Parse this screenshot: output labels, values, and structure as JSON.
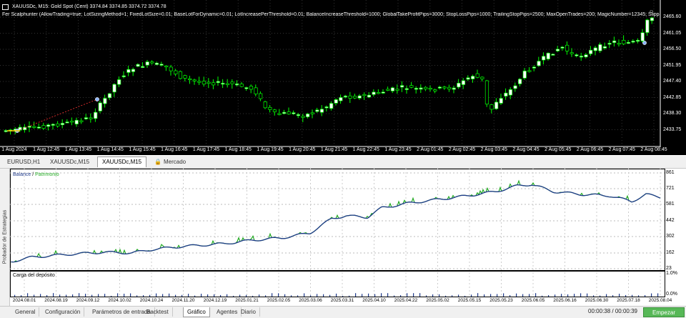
{
  "chart": {
    "header": "XAUUSDc, M15:  Gold Spot (Cent)  3374.84 3374.85 3374.72 3374.78",
    "ea_params": "Fer Scalphunter (AllowTrading=true; LotSizingMethod=1; FixedLotSize=0.01; BaseLotForDynamic=0.01; LotIncreasePerThreshold=0.01; BalanceIncreaseThreshold=1000; GlobalTakeProfitPips=3000; StopLossPips=1000; TrailingStopPips=2500; MaxOpenTrades=200; MagicNumber=12345; SlippagePips=5; AllowInversion=...",
    "price_labels": [
      "2465.60",
      "2461.05",
      "2456.50",
      "2451.95",
      "2447.40",
      "2442.85",
      "2438.30",
      "2433.75"
    ],
    "time_labels": [
      "1 Aug 2024",
      "1 Aug 12:45",
      "1 Aug 13:45",
      "1 Aug 14:45",
      "1 Aug 15:45",
      "1 Aug 16:45",
      "1 Aug 17:45",
      "1 Aug 18:45",
      "1 Aug 19:45",
      "1 Aug 20:45",
      "1 Aug 21:45",
      "1 Aug 22:45",
      "1 Aug 23:45",
      "2 Aug 01:45",
      "2 Aug 02:45",
      "2 Aug 03:45",
      "2 Aug 04:45",
      "2 Aug 05:45",
      "2 Aug 06:45",
      "2 Aug 07:45",
      "2 Aug 08:45"
    ],
    "colors": {
      "bull": "#ffffff",
      "bear": "#000000",
      "outline": "#00ff00",
      "background": "#000000"
    }
  },
  "chart_tabs": [
    {
      "label": "EURUSD,H1"
    },
    {
      "label": "XAUUSDc,M15"
    },
    {
      "label": "XAUUSDc,M15",
      "active": true
    },
    {
      "label": "Mercado",
      "icon": "lock-icon"
    }
  ],
  "tester": {
    "side_label": "Probador de Estrategias",
    "legend_balance": "Balance",
    "legend_sep": " / ",
    "legend_equity": "Patrimonio",
    "balance_ticks": [
      "861",
      "721",
      "581",
      "442",
      "302",
      "162",
      "23"
    ],
    "deposit_label": "Carga del depósito",
    "deposit_ticks": [
      "1.0%",
      "0.0%"
    ],
    "date_labels": [
      "2024.08.01",
      "2024.08.19",
      "2024.09.12",
      "2024.10.02",
      "2024.10.24",
      "2024.11.20",
      "2024.12.19",
      "2025.01.21",
      "2025.02.05",
      "2025.03.06",
      "2025.03.31",
      "2025.04.10",
      "2025.04.22",
      "2025.05.02",
      "2025.05.15",
      "2025.05.23",
      "2025.06.05",
      "2025.06.16",
      "2025.06.30",
      "2025.07.18",
      "2025.08.04"
    ],
    "colors": {
      "balance": "#1f3a8a",
      "equity": "#22aa22"
    }
  },
  "bottom_tabs": [
    {
      "label": "General"
    },
    {
      "label": "Configuración"
    },
    {
      "label": "Parámetros de entrada"
    },
    {
      "label": "Backtest"
    },
    {
      "label": "Gráfico",
      "active": true
    },
    {
      "label": "Agentes"
    },
    {
      "label": "Diario"
    }
  ],
  "timer": "00:00:38 / 00:00:39",
  "start_button": "Empezar"
}
